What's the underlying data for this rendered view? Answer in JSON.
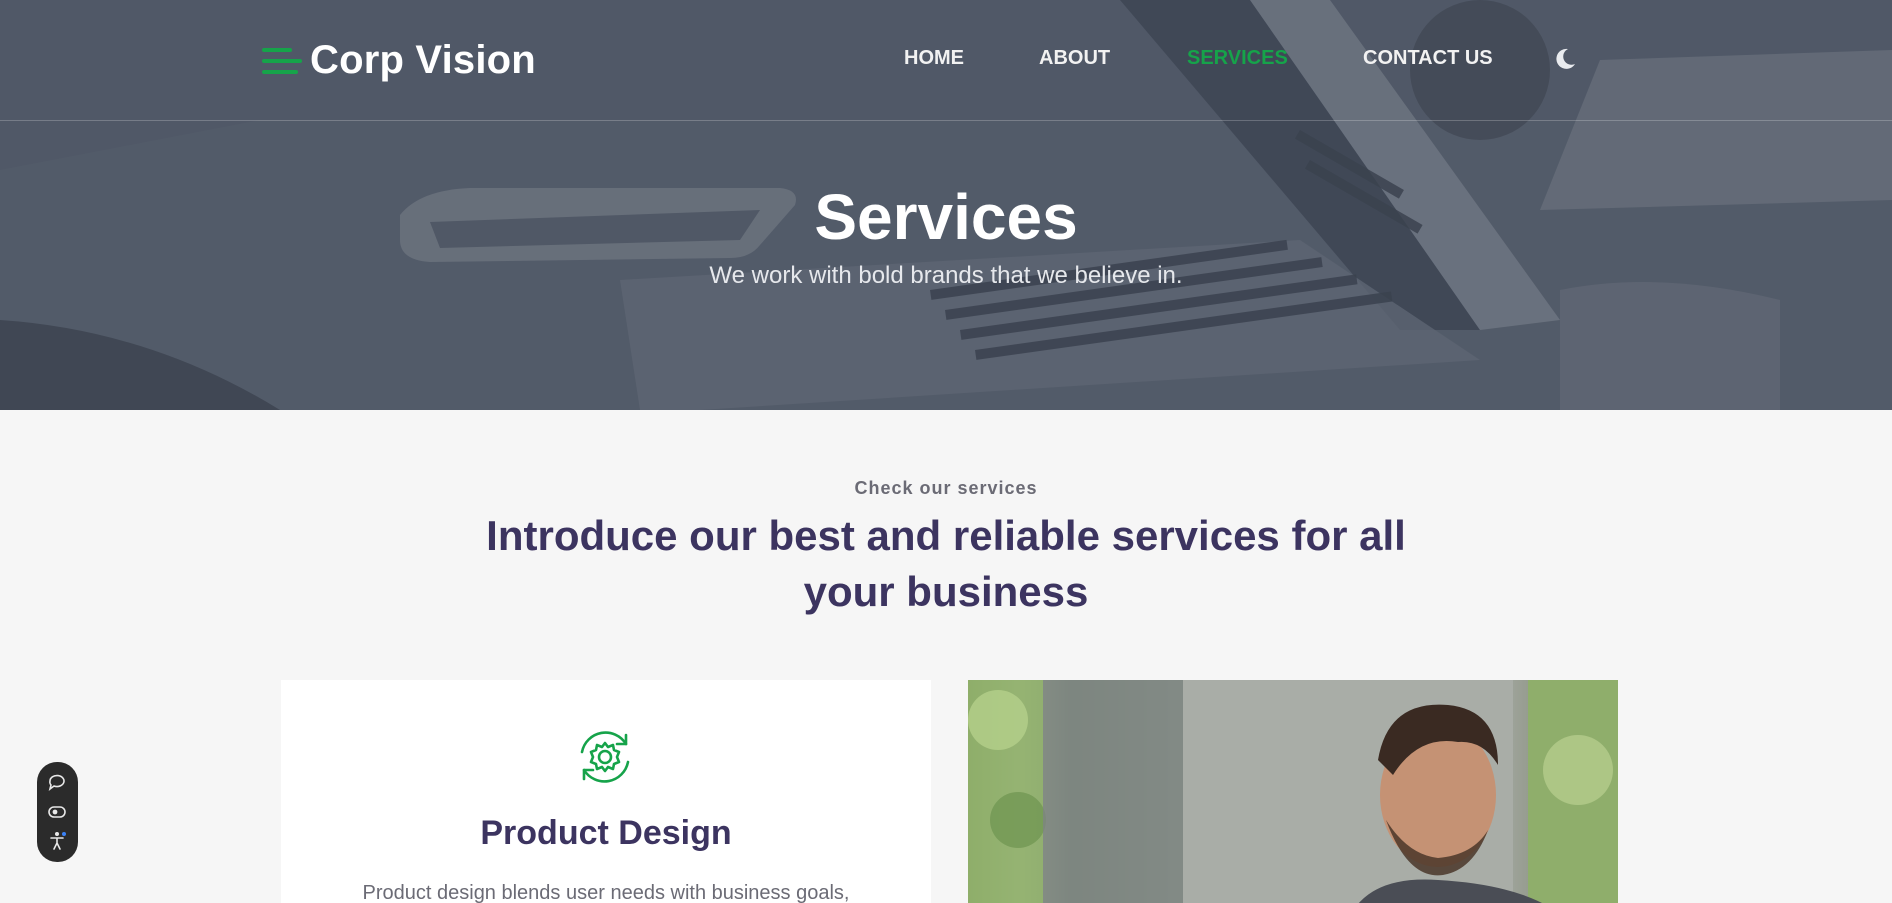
{
  "brand": {
    "name": "Corp Vision",
    "accent_color": "#16a34a"
  },
  "nav": {
    "items": [
      {
        "label": "HOME",
        "active": false
      },
      {
        "label": "ABOUT",
        "active": false
      },
      {
        "label": "SERVICES",
        "active": true
      },
      {
        "label": "CONTACT US",
        "active": false
      }
    ],
    "theme_toggle_icon": "moon-icon"
  },
  "hero": {
    "title": "Services",
    "subtitle": "We work with bold brands that we believe in."
  },
  "services_section": {
    "eyebrow": "Check our services",
    "title": "Introduce our best and reliable services for all your business",
    "title_color": "#3c3460"
  },
  "service_card": {
    "icon": "gear-cycle-icon",
    "title": "Product Design",
    "text": "Product design blends user needs with business goals,"
  },
  "accessibility_widget": {
    "buttons": [
      "chat-icon",
      "eye-icon",
      "accessibility-icon"
    ]
  }
}
